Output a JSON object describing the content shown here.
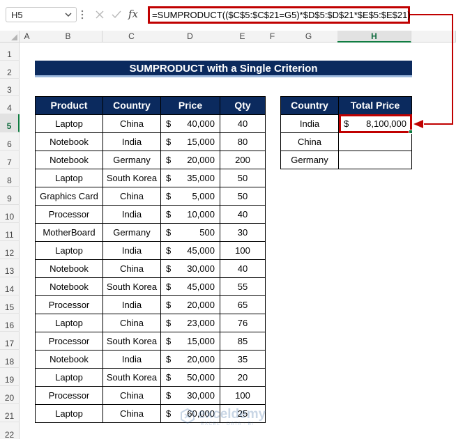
{
  "formula_bar": {
    "name_box": "H5",
    "fx_label": "fx",
    "formula": "=SUMPRODUCT(($C$5:$C$21=G5)*$D$5:$D$21*$E$5:$E$21)"
  },
  "columns": [
    "A",
    "B",
    "C",
    "D",
    "E",
    "F",
    "G",
    "H"
  ],
  "selected_column": "H",
  "rows": [
    "1",
    "2",
    "3",
    "4",
    "5",
    "6",
    "7",
    "8",
    "9",
    "10",
    "11",
    "12",
    "13",
    "14",
    "15",
    "16",
    "17",
    "18",
    "19",
    "20",
    "21",
    "22"
  ],
  "selected_row": "5",
  "title": "SUMPRODUCT with a Single Criterion",
  "main_table": {
    "headers": [
      "Product",
      "Country",
      "Price",
      "Qty"
    ],
    "currency": "$",
    "rows": [
      {
        "product": "Laptop",
        "country": "China",
        "price": "40,000",
        "qty": "40"
      },
      {
        "product": "Notebook",
        "country": "India",
        "price": "15,000",
        "qty": "80"
      },
      {
        "product": "Notebook",
        "country": "Germany",
        "price": "20,000",
        "qty": "200"
      },
      {
        "product": "Laptop",
        "country": "South Korea",
        "price": "35,000",
        "qty": "50"
      },
      {
        "product": "Graphics Card",
        "country": "China",
        "price": "5,000",
        "qty": "50"
      },
      {
        "product": "Processor",
        "country": "India",
        "price": "10,000",
        "qty": "40"
      },
      {
        "product": "MotherBoard",
        "country": "Germany",
        "price": "500",
        "qty": "30"
      },
      {
        "product": "Laptop",
        "country": "India",
        "price": "45,000",
        "qty": "100"
      },
      {
        "product": "Notebook",
        "country": "China",
        "price": "30,000",
        "qty": "40"
      },
      {
        "product": "Notebook",
        "country": "South Korea",
        "price": "45,000",
        "qty": "55"
      },
      {
        "product": "Processor",
        "country": "India",
        "price": "20,000",
        "qty": "65"
      },
      {
        "product": "Laptop",
        "country": "China",
        "price": "23,000",
        "qty": "76"
      },
      {
        "product": "Processor",
        "country": "South Korea",
        "price": "15,000",
        "qty": "85"
      },
      {
        "product": "Notebook",
        "country": "India",
        "price": "20,000",
        "qty": "35"
      },
      {
        "product": "Laptop",
        "country": "South Korea",
        "price": "50,000",
        "qty": "20"
      },
      {
        "product": "Processor",
        "country": "China",
        "price": "30,000",
        "qty": "100"
      },
      {
        "product": "Laptop",
        "country": "China",
        "price": "60,000",
        "qty": "25"
      }
    ]
  },
  "result_table": {
    "headers": [
      "Country",
      "Total Price"
    ],
    "rows": [
      {
        "country": "India",
        "currency": "$",
        "total": "8,100,000"
      },
      {
        "country": "China",
        "currency": "",
        "total": ""
      },
      {
        "country": "Germany",
        "currency": "",
        "total": ""
      }
    ]
  },
  "watermark": {
    "name": "exceldemy",
    "tagline": "EXCEL · DATA · BI"
  },
  "colors": {
    "header_fill": "#0b2a5e",
    "highlight": "#c00000",
    "excel_green": "#107c41"
  }
}
